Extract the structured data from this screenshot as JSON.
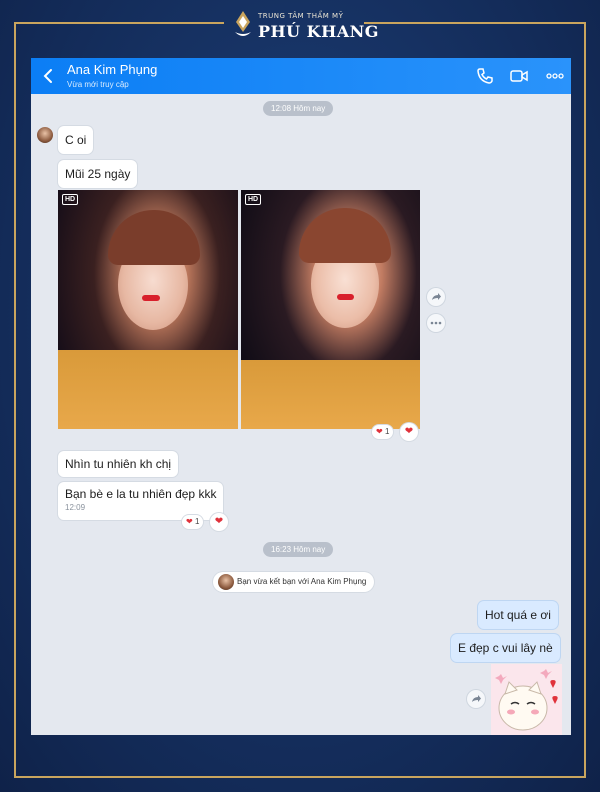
{
  "brand": {
    "small": "TRUNG TÂM THẨM MỸ",
    "big": "PHÚ KHANG"
  },
  "header": {
    "name": "Ana Kim Phụng",
    "status": "Vừa mới truy cập"
  },
  "messages": {
    "time1": "12:08 Hôm nay",
    "m1": "C oi",
    "m2": "Mũi 25 ngày",
    "hd1": "HD",
    "hd2": "HD",
    "react1_count": "1",
    "m3": "Nhìn tu nhiên kh chị",
    "m4": "Bạn bè e la tu nhiên đẹp kkk",
    "m4_time": "12:09",
    "react2_count": "1",
    "time2": "16:23 Hôm nay",
    "system": "Bạn vừa kết bạn với Ana Kim Phụng",
    "m5": "Hot quá e ơi",
    "m6": "E đẹp c vui lây nè"
  },
  "colors": {
    "header": "#0b7ef5",
    "background": "#e4e8ef",
    "outgoing": "#d9eaff",
    "frame": "#15305f",
    "gold": "#c9a55e",
    "heart": "#e0323b"
  },
  "icons": {
    "back": "chevron-left-icon",
    "call": "phone-icon",
    "video": "video-camera-icon",
    "more": "more-dots-icon",
    "forward": "share-icon",
    "options": "more-dots-icon",
    "heart": "heart-icon"
  }
}
